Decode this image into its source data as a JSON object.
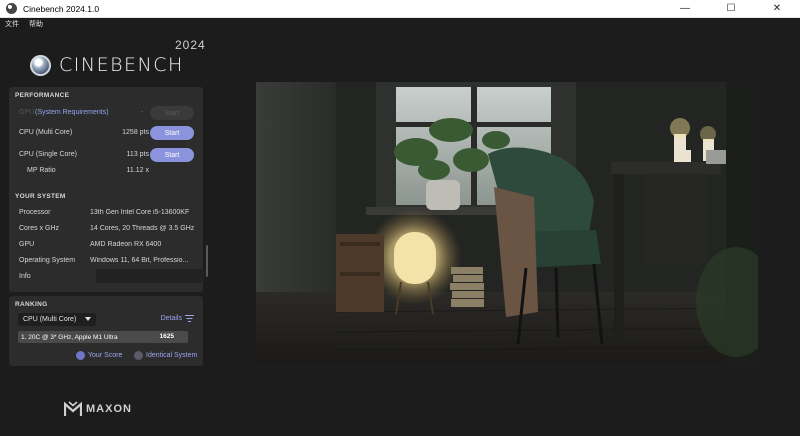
{
  "window": {
    "title": "Cinebench 2024.1.0",
    "minimize": "—",
    "maximize": "☐",
    "close": "✕"
  },
  "menu": {
    "items": [
      "文件",
      "帮助"
    ]
  },
  "logo": {
    "word": "CINEBENCH",
    "year": "2024"
  },
  "performance": {
    "title": "PERFORMANCE",
    "gpu_label": "GPU",
    "gpu_note": "(System Requirements)",
    "gpu_dash": "-",
    "gpu_start": "Start",
    "multi_label": "CPU (Multi Core)",
    "multi_pts": "1258 pts",
    "multi_start": "Start",
    "single_label": "CPU (Single Core)",
    "single_pts": "113 pts",
    "single_start": "Start",
    "mp_label": "MP Ratio",
    "mp_value": "11.12 x"
  },
  "system": {
    "title": "YOUR SYSTEM",
    "rows": [
      {
        "label": "Processor",
        "value": "13th Gen Intel Core i5-13600KF"
      },
      {
        "label": "Cores x GHz",
        "value": "14 Cores, 20 Threads @ 3.5 GHz"
      },
      {
        "label": "GPU",
        "value": "AMD Radeon RX 6400"
      },
      {
        "label": "Operating System",
        "value": "Windows 11, 64 Bit, Professio..."
      },
      {
        "label": "Info",
        "value": ""
      }
    ]
  },
  "ranking": {
    "title": "RANKING",
    "dropdown": "CPU (Multi Core)",
    "details": "Details",
    "entry": "1. 20C @ 3* GHz, Apple M1 Ultra",
    "entry_score": "1625",
    "legend_your": "Your Score",
    "legend_identical": "Identical System",
    "colors": {
      "your": "#6f76c9",
      "identical": "#5a5a6a"
    }
  },
  "footer": {
    "brand": "MAXON"
  }
}
